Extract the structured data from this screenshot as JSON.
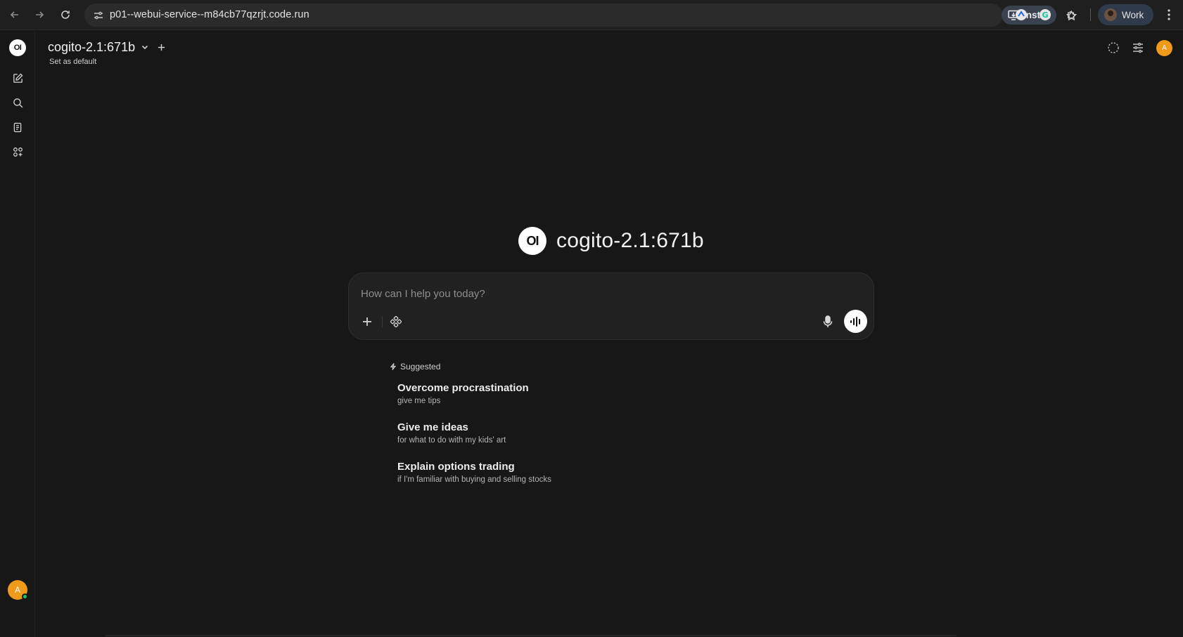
{
  "browser": {
    "url": "p01--webui-service--m84cb77qzrjt.code.run",
    "install_label": "Install",
    "profile_label": "Work",
    "icons": [
      "back-icon",
      "forward-icon",
      "reload-icon",
      "site-info-icon",
      "install-app-icon",
      "bookmark-star-icon",
      "extension-icon",
      "grammarly-icon",
      "puzzle-icon",
      "menu-kebab-icon"
    ]
  },
  "sidebar": {
    "logo_text": "OI",
    "items": [
      {
        "name": "new-chat",
        "icon": "edit-icon"
      },
      {
        "name": "search",
        "icon": "search-icon"
      },
      {
        "name": "notes",
        "icon": "notes-icon"
      },
      {
        "name": "workspace",
        "icon": "apps-icon"
      }
    ],
    "user_initial": "A"
  },
  "header": {
    "model_name": "cogito-2.1:671b",
    "set_default_label": "Set as default",
    "user_initial": "A"
  },
  "hero": {
    "logo_text": "OI",
    "title": "cogito-2.1:671b"
  },
  "prompt": {
    "placeholder": "How can I help you today?",
    "value": ""
  },
  "suggestions": {
    "heading": "Suggested",
    "items": [
      {
        "title": "Overcome procrastination",
        "subtitle": "give me tips"
      },
      {
        "title": "Give me ideas",
        "subtitle": "for what to do with my kids' art"
      },
      {
        "title": "Explain options trading",
        "subtitle": "if I'm familiar with buying and selling stocks"
      }
    ]
  },
  "colors": {
    "background": "#171717",
    "accent_avatar": "#f09a1a",
    "online": "#22c55e"
  }
}
